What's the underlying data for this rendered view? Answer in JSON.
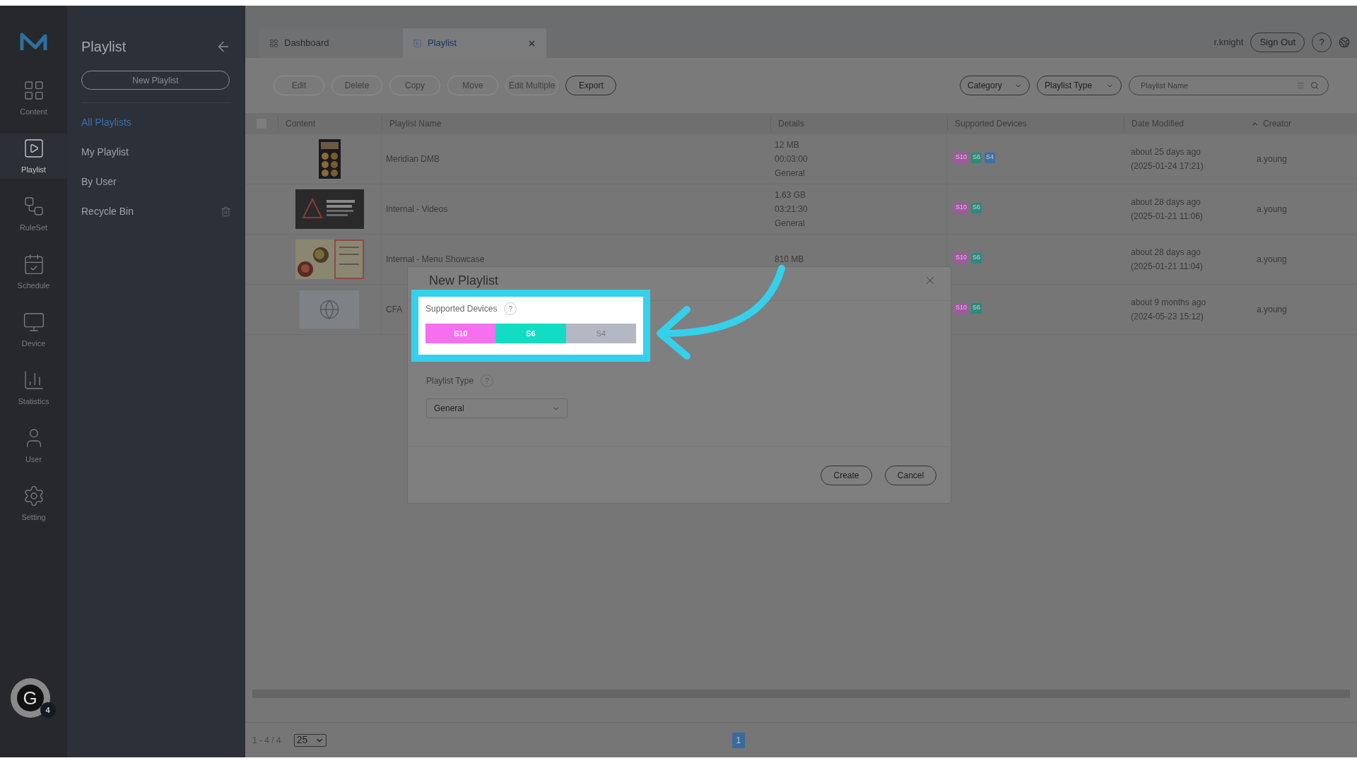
{
  "nav_rail": {
    "items": [
      {
        "kind": "content",
        "label": "Content",
        "selected": false
      },
      {
        "kind": "playlist",
        "label": "Playlist",
        "selected": true
      },
      {
        "kind": "ruleset",
        "label": "RuleSet",
        "selected": false
      },
      {
        "kind": "schedule",
        "label": "Schedule",
        "selected": false
      },
      {
        "kind": "device",
        "label": "Device",
        "selected": false
      },
      {
        "kind": "statistics",
        "label": "Statistics",
        "selected": false
      },
      {
        "kind": "user",
        "label": "User",
        "selected": false
      },
      {
        "kind": "setting",
        "label": "Setting",
        "selected": false
      }
    ],
    "assistant": {
      "letter": "G",
      "badge": "4"
    }
  },
  "panel": {
    "title": "Playlist",
    "new_button": "New Playlist",
    "items": [
      {
        "label": "All Playlists",
        "selected": true,
        "trash": false
      },
      {
        "label": "My Playlist",
        "selected": false,
        "trash": false
      },
      {
        "label": "By User",
        "selected": false,
        "trash": false
      },
      {
        "label": "Recycle Bin",
        "selected": false,
        "trash": true
      }
    ]
  },
  "tabs": [
    {
      "kind": "dashboard",
      "label": "Dashboard",
      "selected": false
    },
    {
      "kind": "playlist",
      "label": "Playlist",
      "selected": true
    }
  ],
  "user": {
    "name": "r.knight",
    "sign_out": "Sign Out",
    "help": "?"
  },
  "toolbar": {
    "buttons": [
      {
        "label": "Edit",
        "disabled": true
      },
      {
        "label": "Delete",
        "disabled": true
      },
      {
        "label": "Copy",
        "disabled": true
      },
      {
        "label": "Move",
        "disabled": true
      },
      {
        "label": "Edit Multiple",
        "disabled": true
      },
      {
        "label": "Export",
        "disabled": false
      }
    ],
    "filters": [
      "Category",
      "Playlist Type"
    ],
    "search": {
      "placeholder": "Playlist Name"
    }
  },
  "table": {
    "select_all": {
      "checked": false
    },
    "columns": [
      {
        "label": "Content",
        "sorted": false
      },
      {
        "label": "Playlist Name",
        "sorted": false
      },
      {
        "label": "Details",
        "sorted": false
      },
      {
        "label": "Supported Devices",
        "sorted": false
      },
      {
        "label": "Date Modified",
        "sorted": false
      },
      {
        "label": "Creator",
        "sorted": true
      }
    ],
    "rows": [
      {
        "kind": "picture",
        "name": "Meridian DMB",
        "details": [
          "12 MB",
          "00:03:00",
          "General"
        ],
        "devices": [
          {
            "label": "S10",
            "color": "#a555a3"
          },
          {
            "label": "S6",
            "color": "#2a8a80"
          },
          {
            "label": "S4",
            "color": "#3a6fa8"
          }
        ],
        "modified": "about 25 days ago",
        "modified_exact": "(2025-01-24 17:21)",
        "creator": "a.young"
      },
      {
        "kind": "picture",
        "name": "Internal - Videos",
        "details": [
          "1.63 GB",
          "03:21:30",
          "General"
        ],
        "devices": [
          {
            "label": "S10",
            "color": "#a555a3"
          },
          {
            "label": "S6",
            "color": "#2a8a80"
          }
        ],
        "modified": "about 28 days ago",
        "modified_exact": "(2025-01-21 11:06)",
        "creator": "a.young"
      },
      {
        "kind": "picture",
        "name": "Internal - Menu Showcase",
        "details": [
          "810 MB"
        ],
        "devices": [
          {
            "label": "S10",
            "color": "#a555a3"
          },
          {
            "label": "S6",
            "color": "#2a8a80"
          }
        ],
        "modified": "about 28 days ago",
        "modified_exact": "(2025-01-21 11:04)",
        "creator": "a.young"
      },
      {
        "kind": "placeholder",
        "name": "CFA",
        "details": [],
        "devices": [
          {
            "label": "S10",
            "color": "#a555a3"
          },
          {
            "label": "S6",
            "color": "#2a8a80"
          }
        ],
        "modified": "about 9 months ago",
        "modified_exact": "(2024-05-23 15:12)",
        "creator": "a.young"
      }
    ]
  },
  "footer": {
    "range": "1 - 4 / 4",
    "page_size": "25",
    "pages": [
      {
        "label": "1",
        "selected": true
      }
    ]
  },
  "modal": {
    "title": "New Playlist",
    "devices_label": "Supported Devices",
    "devices_help": "?",
    "devices": [
      {
        "label": "S10",
        "selected": true,
        "color": "#f56ff0"
      },
      {
        "label": "S6",
        "selected": true,
        "color": "#14dbc4"
      },
      {
        "label": "S4",
        "selected": false,
        "color": "#b4b8c2"
      }
    ],
    "type_label": "Playlist Type",
    "type_help": "?",
    "type_value": "General",
    "buttons": [
      "Create",
      "Cancel"
    ]
  }
}
